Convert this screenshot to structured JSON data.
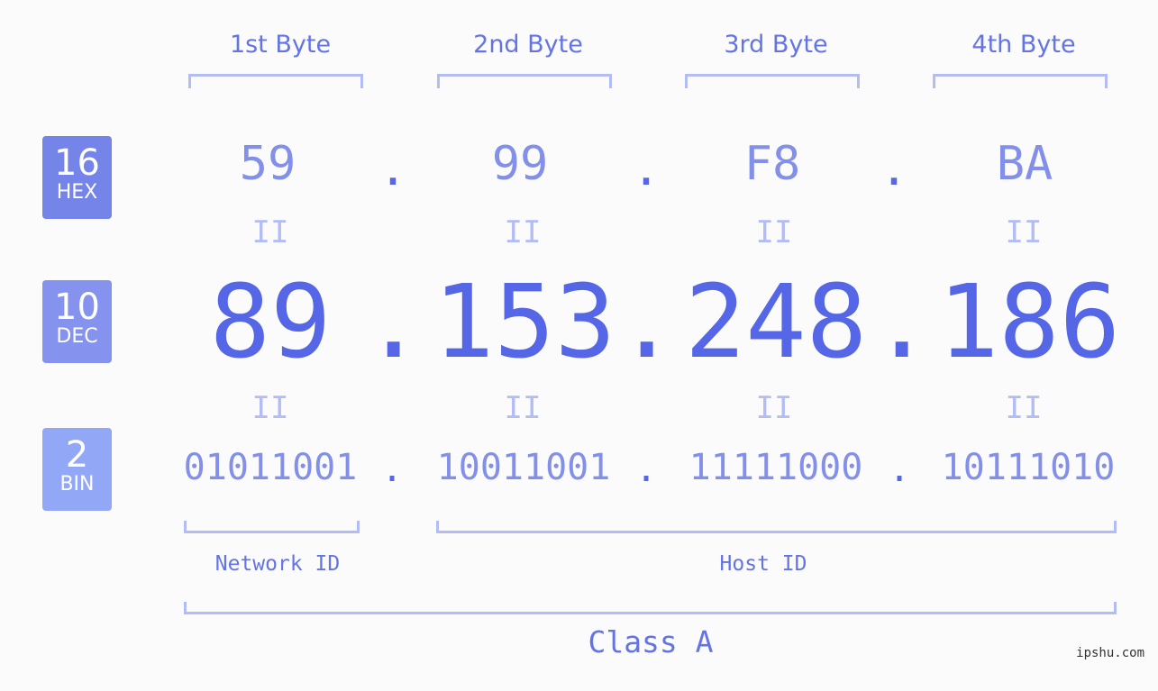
{
  "bytes": [
    {
      "label": "1st Byte",
      "hex": "59",
      "dec": "89",
      "bin": "01011001"
    },
    {
      "label": "2nd Byte",
      "hex": "99",
      "dec": "153",
      "bin": "10011001"
    },
    {
      "label": "3rd Byte",
      "hex": "F8",
      "dec": "248",
      "bin": "11111000"
    },
    {
      "label": "4th Byte",
      "hex": "BA",
      "dec": "186",
      "bin": "10111010"
    }
  ],
  "bases": {
    "hex": {
      "num": "16",
      "label": "HEX",
      "color": "#7584e9"
    },
    "dec": {
      "num": "10",
      "label": "DEC",
      "color": "#8593ef"
    },
    "bin": {
      "num": "2",
      "label": "BIN",
      "color": "#93a7f7"
    }
  },
  "separator": ".",
  "equals": "II",
  "network_id_label": "Network ID",
  "host_id_label": "Host ID",
  "class_label": "Class A",
  "watermark": "ipshu.com"
}
